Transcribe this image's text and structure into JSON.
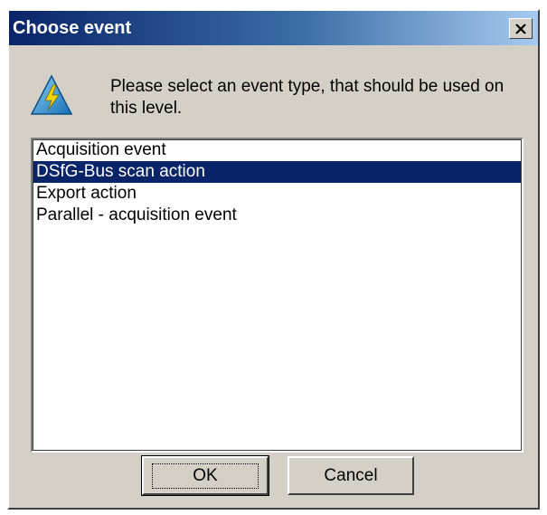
{
  "window": {
    "title": "Choose event"
  },
  "prompt": "Please select an event type, that should be used on this level.",
  "event_types": [
    {
      "label": "Acquisition event",
      "selected": false
    },
    {
      "label": "DSfG-Bus scan action",
      "selected": true
    },
    {
      "label": "Export action",
      "selected": false
    },
    {
      "label": "Parallel - acquisition event",
      "selected": false
    }
  ],
  "buttons": {
    "ok_label": "OK",
    "cancel_label": "Cancel"
  },
  "icons": {
    "close": "close-icon",
    "event": "lightning-event-icon"
  },
  "colors": {
    "titlebar_start": "#0a246a",
    "titlebar_end": "#a6caf0",
    "selection": "#0a246a",
    "face": "#d4d0c8"
  }
}
